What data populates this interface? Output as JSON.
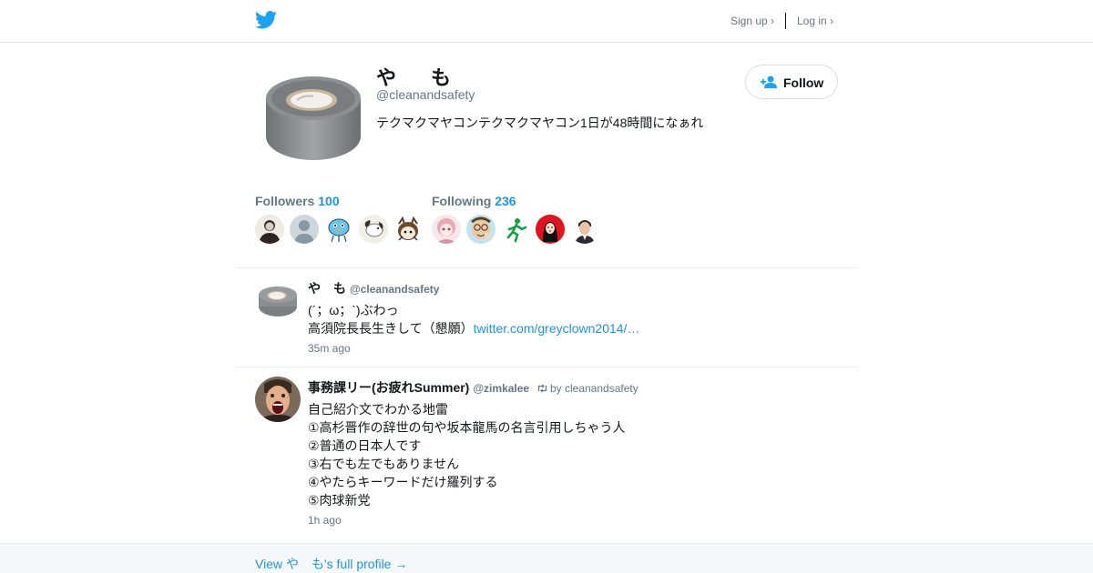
{
  "header": {
    "logo_icon": "twitter-bird-icon",
    "signup_label": "Sign up ›",
    "login_label": "Log in ›",
    "accent": "#1da1f2"
  },
  "profile": {
    "name": "や　も",
    "handle": "@cleanandsafety",
    "bio": "テクマクマヤコンテクマクマヤコン1日が48時間になぁれ",
    "avatar_icon": "duct-tape-avatar",
    "follow_label": "Follow",
    "follow_icon": "add-user-icon"
  },
  "stats": {
    "followers_label": "Followers",
    "followers_count": "100",
    "following_label": "Following",
    "following_count": "236"
  },
  "followers_avatars": [
    "avatar-portrait-sketch",
    "avatar-default-person",
    "avatar-blue-bird-cartoon",
    "avatar-gull-drawing",
    "avatar-horned-figure"
  ],
  "following_avatars": [
    "avatar-anime-girl",
    "avatar-glasses-man",
    "avatar-running-person",
    "avatar-red-circle-woman",
    "avatar-man-portrait"
  ],
  "tweets": [
    {
      "name": "や　も",
      "handle": "@cleanandsafety",
      "retweet_by": "",
      "line1": "(´；ω；`)ぶわっ",
      "line2_text": "高須院長長生きして（懇願）",
      "line2_link": "twitter.com/greyclown2014/…",
      "time": "35m ago"
    },
    {
      "name": "事務課リー(お疲れSummer)",
      "handle": "@zimkalee",
      "retweet_by": "by cleanandsafety",
      "retweet_icon": "retweet-icon",
      "lines": [
        "自己紹介文でわかる地雷",
        "①高杉晋作の辞世の句や坂本龍馬の名言引用しちゃう人",
        "②普通の日本人です",
        "③右でも左でもありません",
        "④やたらキーワードだけ羅列する",
        "⑤肉球新党"
      ],
      "time": "1h ago"
    }
  ],
  "footer": {
    "link_label": "View や　も's full profile →"
  }
}
